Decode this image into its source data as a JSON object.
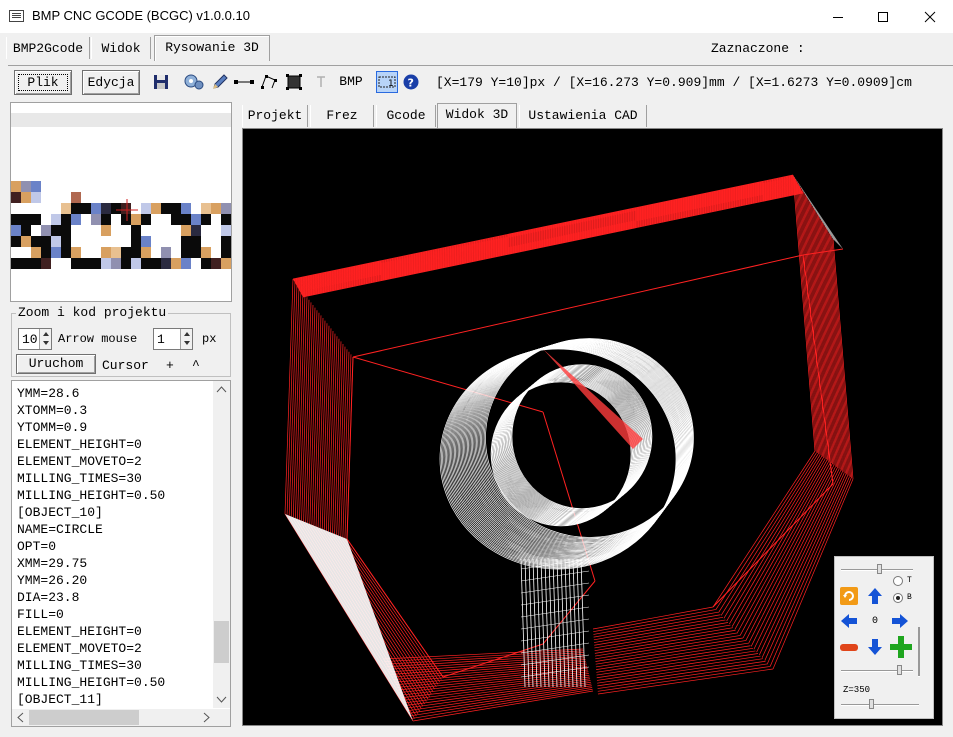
{
  "window": {
    "title": "BMP CNC GCODE (BCGC) v1.0.0.10"
  },
  "main_tabs": [
    {
      "label": "BMP2Gcode"
    },
    {
      "label": "Widok"
    },
    {
      "label": "Rysowanie 3D"
    }
  ],
  "selected_label": "Zaznaczone :",
  "toolbar": {
    "plik_label": "Plik",
    "edycja_label": "Edycja",
    "bmp_label": "BMP",
    "coords": "[X=179 Y=10]px / [X=16.273 Y=0.909]mm / [X=1.6273 Y=0.0909]cm"
  },
  "zoom_group": {
    "title": "Zoom i kod projektu",
    "zoom_value": "10",
    "arrow_mouse_label": "Arrow mouse",
    "arrow_value": "1",
    "px_label": "px",
    "run_label": "Uruchom",
    "cursor_label": "Cursor",
    "plus_label": "+",
    "caret_label": "^"
  },
  "code_lines": [
    "YMM=28.6",
    "XTOMM=0.3",
    "YTOMM=0.9",
    "ELEMENT_HEIGHT=0",
    "ELEMENT_MOVETO=2",
    "MILLING_TIMES=30",
    "MILLING_HEIGHT=0.50",
    "[OBJECT_10]",
    "NAME=CIRCLE",
    "OPT=0",
    "XMM=29.75",
    "YMM=26.20",
    "DIA=23.8",
    "FILL=0",
    "ELEMENT_HEIGHT=0",
    "ELEMENT_MOVETO=2",
    "MILLING_TIMES=30",
    "MILLING_HEIGHT=0.50",
    "[OBJECT_11]"
  ],
  "sub_tabs": [
    {
      "label": "Projekt"
    },
    {
      "label": "Frez"
    },
    {
      "label": "Gcode"
    },
    {
      "label": "Widok 3D"
    },
    {
      "label": "Ustawienia CAD"
    }
  ],
  "nav": {
    "radio_t": "T",
    "radio_b": "B",
    "center_value": "0",
    "z_label": "Z=350"
  },
  "colors": {
    "frame": "#ff2222",
    "circle": "#ffffff",
    "background": "#000000",
    "accent": "#ff9900"
  }
}
